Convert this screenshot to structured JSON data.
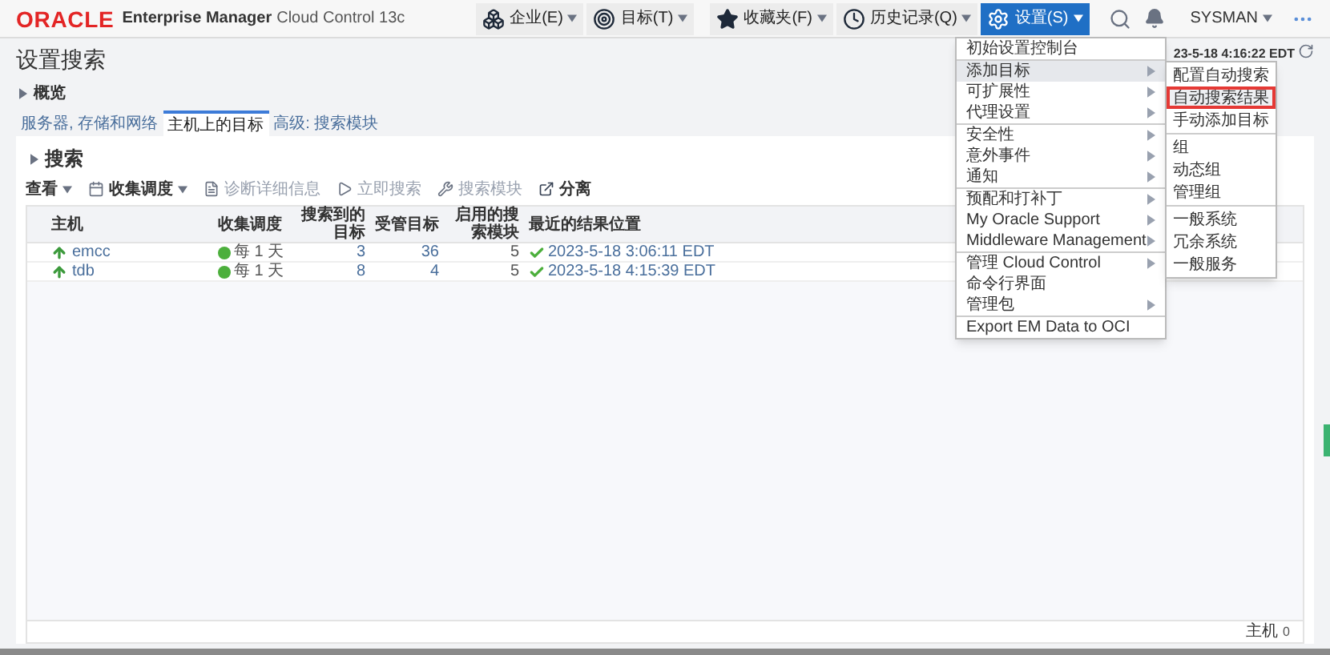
{
  "header": {
    "logo": "ORACLE",
    "product": "Enterprise Manager",
    "edition": "Cloud Control 13c",
    "nav": [
      {
        "label": "企业(E)",
        "kind": "enterprise",
        "selected": false
      },
      {
        "label": "目标(T)",
        "kind": "targets",
        "selected": false
      },
      {
        "label": "收藏夹(F)",
        "kind": "favorites",
        "selected": false
      },
      {
        "label": "历史记录(Q)",
        "kind": "history",
        "selected": false
      },
      {
        "label": "设置(S)",
        "kind": "setup",
        "selected": true
      }
    ],
    "user": "SYSMAN"
  },
  "page": {
    "title": "设置搜索",
    "overview": "概览",
    "timestamp": "23-5-18 4:16:22 EDT"
  },
  "tabs": [
    {
      "label": "服务器, 存储和网络",
      "selected": false
    },
    {
      "label": "主机上的目标",
      "selected": true
    },
    {
      "label": "高级: 搜索模块",
      "selected": false
    }
  ],
  "search": {
    "title": "搜索",
    "toolbar": [
      {
        "label": "查看",
        "kind": "view",
        "disabled": false
      },
      {
        "label": "收集调度",
        "kind": "schedule",
        "disabled": false
      },
      {
        "label": "诊断详细信息",
        "kind": "diagnose",
        "disabled": true
      },
      {
        "label": "立即搜索",
        "kind": "run",
        "disabled": true
      },
      {
        "label": "搜索模块",
        "kind": "modules",
        "disabled": true
      },
      {
        "label": "分离",
        "kind": "detach",
        "disabled": false
      }
    ]
  },
  "table": {
    "columns": [
      "主机",
      "收集调度",
      "搜索到的目标",
      "受管目标",
      "启用的搜索模块",
      "最近的结果位置"
    ],
    "rows": [
      {
        "host": "emcc",
        "online": true,
        "schedule": "每 1 天",
        "found": "3",
        "managed": "36",
        "modules": "5",
        "result": "2023-5-18 3:06:11 EDT"
      },
      {
        "host": "tdb",
        "online": true,
        "schedule": "每 1 天",
        "found": "8",
        "managed": "4",
        "modules": "5",
        "result": "2023-5-18 4:15:39 EDT"
      }
    ]
  },
  "footer": {
    "label": "主机",
    "count": "0"
  },
  "menu": {
    "groups": [
      [
        {
          "label": "初始设置控制台",
          "submenu": false,
          "selected": false
        }
      ],
      [
        {
          "label": "添加目标",
          "submenu": true,
          "selected": true
        },
        {
          "label": "可扩展性",
          "submenu": true,
          "selected": false
        },
        {
          "label": "代理设置",
          "submenu": true,
          "selected": false
        }
      ],
      [
        {
          "label": "安全性",
          "submenu": true,
          "selected": false
        },
        {
          "label": "意外事件",
          "submenu": true,
          "selected": false
        },
        {
          "label": "通知",
          "submenu": true,
          "selected": false
        }
      ],
      [
        {
          "label": "预配和打补丁",
          "submenu": true,
          "selected": false
        },
        {
          "label": "My Oracle Support",
          "submenu": true,
          "selected": false
        },
        {
          "label": "Middleware Management",
          "submenu": true,
          "selected": false
        }
      ],
      [
        {
          "label": "管理 Cloud Control",
          "submenu": true,
          "selected": false
        },
        {
          "label": "命令行界面",
          "submenu": false,
          "selected": false
        },
        {
          "label": "管理包",
          "submenu": true,
          "selected": false
        }
      ],
      [
        {
          "label": "Export EM Data to OCI",
          "submenu": false,
          "selected": false
        }
      ]
    ]
  },
  "submenu": {
    "groups": [
      [
        {
          "label": "配置自动搜索",
          "selected": false
        },
        {
          "label": "自动搜索结果",
          "selected": true
        },
        {
          "label": "手动添加目标",
          "selected": false
        }
      ],
      [
        {
          "label": "组",
          "selected": false
        },
        {
          "label": "动态组",
          "selected": false
        },
        {
          "label": "管理组",
          "selected": false
        }
      ],
      [
        {
          "label": "一般系统",
          "selected": false
        },
        {
          "label": "冗余系统",
          "selected": false
        },
        {
          "label": "一般服务",
          "selected": false
        }
      ]
    ]
  }
}
